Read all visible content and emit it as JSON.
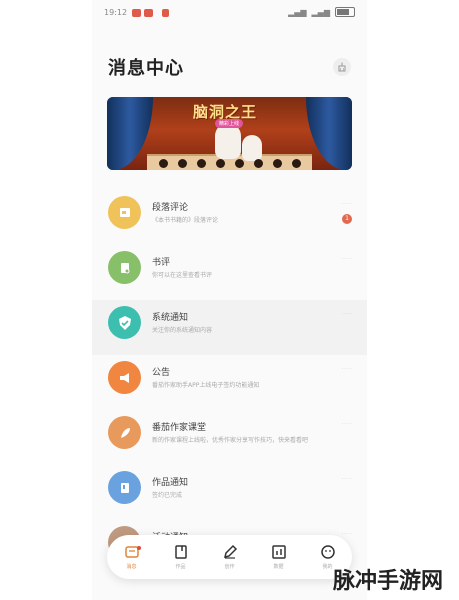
{
  "status_bar": {
    "time": "19:12",
    "battery_label": ""
  },
  "header": {
    "title": "消息中心",
    "clear_icon": "broom-icon"
  },
  "banner": {
    "title": "脑洞之王",
    "subtitle": "精彩上线"
  },
  "messages": [
    {
      "name": "段落评论",
      "preview": "《本书书籍的》段落评论",
      "badge": "1",
      "icon": "comment-icon",
      "color": "#f0c35a"
    },
    {
      "name": "书评",
      "preview": "你可以在这里查看书评",
      "badge": "",
      "icon": "book-review-icon",
      "color": "#88c06a"
    },
    {
      "name": "系统通知",
      "preview": "关注你的系统通知内容",
      "badge": "",
      "icon": "check-shield-icon",
      "color": "#3dbfb0"
    },
    {
      "name": "公告",
      "preview": "番茄作家助手APP上线电子签约功能通知",
      "badge": "",
      "icon": "megaphone-icon",
      "color": "#f08640"
    },
    {
      "name": "番茄作家课堂",
      "preview": "新的作家课程上线啦，优秀作家分享写作技巧，快来看看吧",
      "badge": "",
      "icon": "feather-icon",
      "color": "#e8995c"
    },
    {
      "name": "作品通知",
      "preview": "签约已完成",
      "badge": "",
      "icon": "book-icon",
      "color": "#6aa2e0"
    },
    {
      "name": "活动通知",
      "preview": "",
      "badge": "",
      "icon": "gift-icon",
      "color": "#c09a80"
    }
  ],
  "tabs": [
    {
      "label": "消息",
      "icon": "message-icon",
      "active": true
    },
    {
      "label": "作品",
      "icon": "notebook-icon",
      "active": false
    },
    {
      "label": "创作",
      "icon": "pen-icon",
      "active": false
    },
    {
      "label": "数据",
      "icon": "chart-icon",
      "active": false
    },
    {
      "label": "我的",
      "icon": "profile-icon",
      "active": false
    }
  ],
  "watermark": "脉冲手游网"
}
